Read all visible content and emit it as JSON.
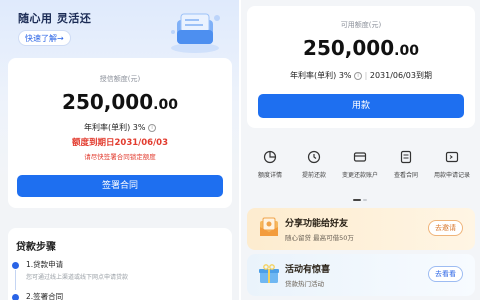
{
  "left": {
    "slogan": "随心用 灵活还",
    "learn_button": "快速了解→",
    "credit": {
      "label": "授信额度(元)",
      "amount_int": "250,000",
      "amount_dec": ".00",
      "rate": "年利率(单利) 3%",
      "expiry": "额度到期日2031/06/03",
      "hint": "请尽快签署合同锁定额度",
      "sign_button": "签署合同"
    },
    "steps": {
      "title": "贷款步骤",
      "items": [
        {
          "title": "1.贷款申请",
          "desc": "您可通过线上渠道或线下网点申请贷款"
        },
        {
          "title": "2.签署合同",
          "desc": ""
        }
      ]
    }
  },
  "right": {
    "available": {
      "label": "可用额度(元)",
      "amount_int": "250,000",
      "amount_dec": ".00",
      "rate": "年利率(单利) 3%",
      "separator": "|",
      "expiry": "2031/06/03到期",
      "use_button": "用款"
    },
    "tools": [
      {
        "label": "额度详情",
        "icon": "pie-chart-icon"
      },
      {
        "label": "提前还款",
        "icon": "clock-icon"
      },
      {
        "label": "变更还款账户",
        "icon": "card-icon"
      },
      {
        "label": "查看合同",
        "icon": "document-icon"
      },
      {
        "label": "用款申请记录",
        "icon": "record-icon"
      }
    ],
    "promos": [
      {
        "title": "分享功能给好友",
        "sub": "随心留贷 最高可借50万",
        "button": "去邀请",
        "icon": "gift-envelope-icon"
      },
      {
        "title": "活动有惊喜",
        "sub": "贷款热门活动",
        "button": "去看看",
        "icon": "gift-box-icon"
      }
    ]
  },
  "colors": {
    "primary": "#1e6ff0",
    "accent_red": "#e23b2e",
    "promo_orange": "#d9772b",
    "promo_blue": "#2a64e6"
  }
}
